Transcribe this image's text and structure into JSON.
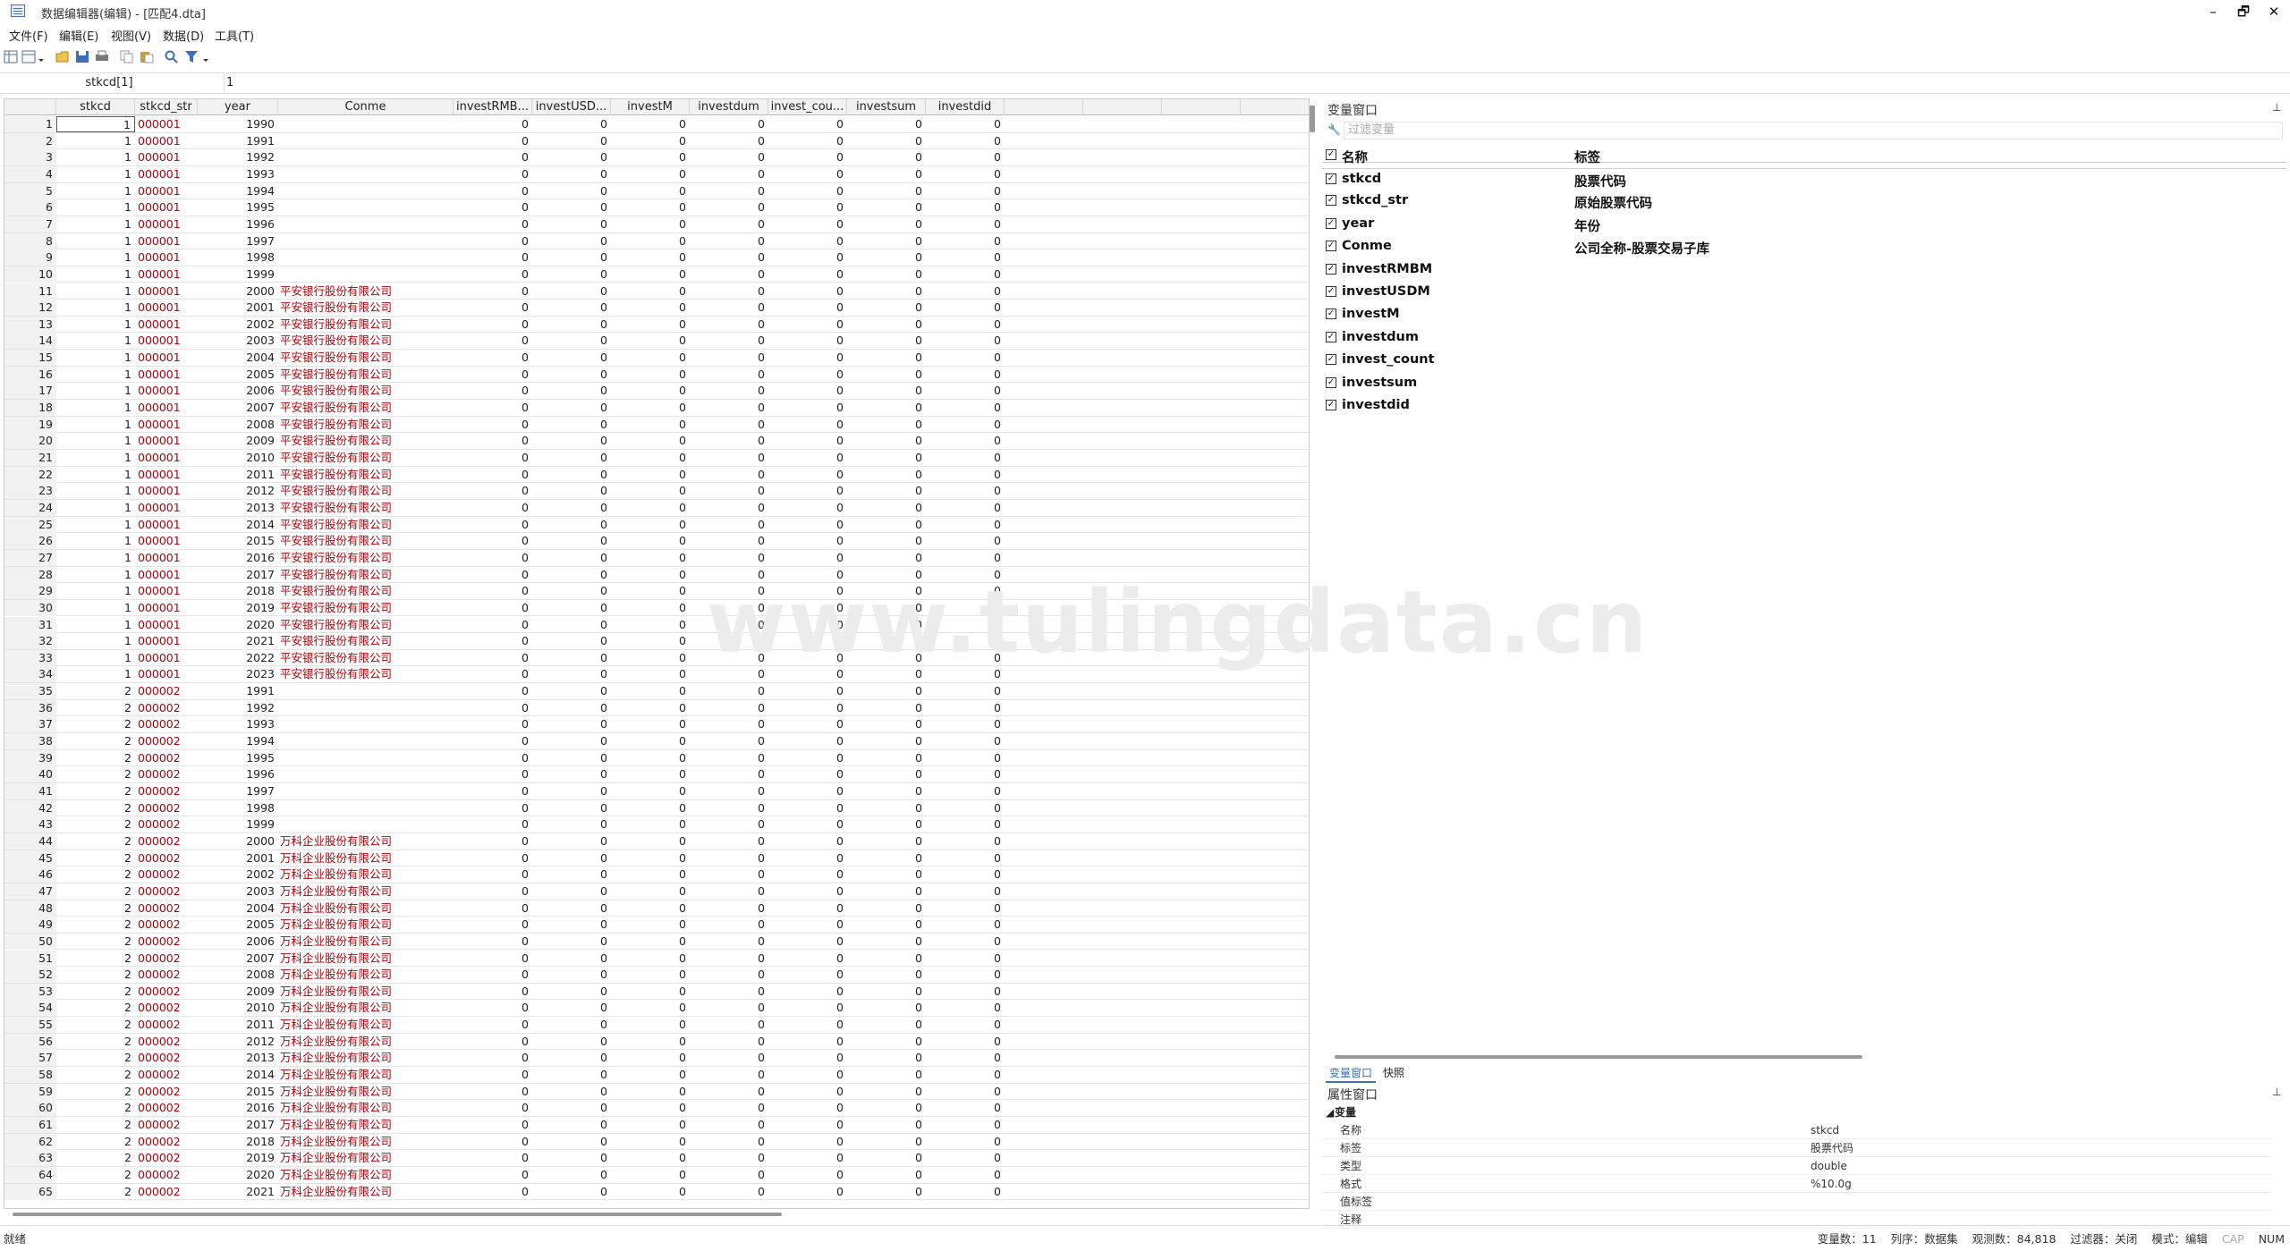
{
  "window": {
    "title": "数据编辑器(编辑) - [匹配4.dta]",
    "minimize": "–",
    "restore": "🗗",
    "close": "✕"
  },
  "menu": [
    "文件(F)",
    "编辑(E)",
    "视图(V)",
    "数据(D)",
    "工具(T)"
  ],
  "toolbar_icons": [
    "data-editor-icon",
    "view-dropdown-icon",
    "open-icon",
    "save-icon",
    "print-icon",
    "copy-icon",
    "paste-icon",
    "find-icon",
    "filter-icon"
  ],
  "editbar": {
    "cell_ref": "stkcd[1]",
    "cell_value": "1"
  },
  "grid": {
    "columns": [
      "stkcd",
      "stkcd_str",
      "year",
      "Conme",
      "investRMB...",
      "investUSD...",
      "investM",
      "investdum",
      "invest_cou...",
      "investsum",
      "investdid"
    ],
    "rows": [
      [
        "1",
        "1",
        "000001",
        "1990",
        "",
        "0",
        "0",
        "0",
        "0",
        "0",
        "0",
        "0"
      ],
      [
        "2",
        "1",
        "000001",
        "1991",
        "",
        "0",
        "0",
        "0",
        "0",
        "0",
        "0",
        "0"
      ],
      [
        "3",
        "1",
        "000001",
        "1992",
        "",
        "0",
        "0",
        "0",
        "0",
        "0",
        "0",
        "0"
      ],
      [
        "4",
        "1",
        "000001",
        "1993",
        "",
        "0",
        "0",
        "0",
        "0",
        "0",
        "0",
        "0"
      ],
      [
        "5",
        "1",
        "000001",
        "1994",
        "",
        "0",
        "0",
        "0",
        "0",
        "0",
        "0",
        "0"
      ],
      [
        "6",
        "1",
        "000001",
        "1995",
        "",
        "0",
        "0",
        "0",
        "0",
        "0",
        "0",
        "0"
      ],
      [
        "7",
        "1",
        "000001",
        "1996",
        "",
        "0",
        "0",
        "0",
        "0",
        "0",
        "0",
        "0"
      ],
      [
        "8",
        "1",
        "000001",
        "1997",
        "",
        "0",
        "0",
        "0",
        "0",
        "0",
        "0",
        "0"
      ],
      [
        "9",
        "1",
        "000001",
        "1998",
        "",
        "0",
        "0",
        "0",
        "0",
        "0",
        "0",
        "0"
      ],
      [
        "10",
        "1",
        "000001",
        "1999",
        "",
        "0",
        "0",
        "0",
        "0",
        "0",
        "0",
        "0"
      ],
      [
        "11",
        "1",
        "000001",
        "2000",
        "平安银行股份有限公司",
        "0",
        "0",
        "0",
        "0",
        "0",
        "0",
        "0"
      ],
      [
        "12",
        "1",
        "000001",
        "2001",
        "平安银行股份有限公司",
        "0",
        "0",
        "0",
        "0",
        "0",
        "0",
        "0"
      ],
      [
        "13",
        "1",
        "000001",
        "2002",
        "平安银行股份有限公司",
        "0",
        "0",
        "0",
        "0",
        "0",
        "0",
        "0"
      ],
      [
        "14",
        "1",
        "000001",
        "2003",
        "平安银行股份有限公司",
        "0",
        "0",
        "0",
        "0",
        "0",
        "0",
        "0"
      ],
      [
        "15",
        "1",
        "000001",
        "2004",
        "平安银行股份有限公司",
        "0",
        "0",
        "0",
        "0",
        "0",
        "0",
        "0"
      ],
      [
        "16",
        "1",
        "000001",
        "2005",
        "平安银行股份有限公司",
        "0",
        "0",
        "0",
        "0",
        "0",
        "0",
        "0"
      ],
      [
        "17",
        "1",
        "000001",
        "2006",
        "平安银行股份有限公司",
        "0",
        "0",
        "0",
        "0",
        "0",
        "0",
        "0"
      ],
      [
        "18",
        "1",
        "000001",
        "2007",
        "平安银行股份有限公司",
        "0",
        "0",
        "0",
        "0",
        "0",
        "0",
        "0"
      ],
      [
        "19",
        "1",
        "000001",
        "2008",
        "平安银行股份有限公司",
        "0",
        "0",
        "0",
        "0",
        "0",
        "0",
        "0"
      ],
      [
        "20",
        "1",
        "000001",
        "2009",
        "平安银行股份有限公司",
        "0",
        "0",
        "0",
        "0",
        "0",
        "0",
        "0"
      ],
      [
        "21",
        "1",
        "000001",
        "2010",
        "平安银行股份有限公司",
        "0",
        "0",
        "0",
        "0",
        "0",
        "0",
        "0"
      ],
      [
        "22",
        "1",
        "000001",
        "2011",
        "平安银行股份有限公司",
        "0",
        "0",
        "0",
        "0",
        "0",
        "0",
        "0"
      ],
      [
        "23",
        "1",
        "000001",
        "2012",
        "平安银行股份有限公司",
        "0",
        "0",
        "0",
        "0",
        "0",
        "0",
        "0"
      ],
      [
        "24",
        "1",
        "000001",
        "2013",
        "平安银行股份有限公司",
        "0",
        "0",
        "0",
        "0",
        "0",
        "0",
        "0"
      ],
      [
        "25",
        "1",
        "000001",
        "2014",
        "平安银行股份有限公司",
        "0",
        "0",
        "0",
        "0",
        "0",
        "0",
        "0"
      ],
      [
        "26",
        "1",
        "000001",
        "2015",
        "平安银行股份有限公司",
        "0",
        "0",
        "0",
        "0",
        "0",
        "0",
        "0"
      ],
      [
        "27",
        "1",
        "000001",
        "2016",
        "平安银行股份有限公司",
        "0",
        "0",
        "0",
        "0",
        "0",
        "0",
        "0"
      ],
      [
        "28",
        "1",
        "000001",
        "2017",
        "平安银行股份有限公司",
        "0",
        "0",
        "0",
        "0",
        "0",
        "0",
        "0"
      ],
      [
        "29",
        "1",
        "000001",
        "2018",
        "平安银行股份有限公司",
        "0",
        "0",
        "0",
        "0",
        "0",
        "0",
        "0"
      ],
      [
        "30",
        "1",
        "000001",
        "2019",
        "平安银行股份有限公司",
        "0",
        "0",
        "0",
        "0",
        "0",
        "0",
        "0"
      ],
      [
        "31",
        "1",
        "000001",
        "2020",
        "平安银行股份有限公司",
        "0",
        "0",
        "0",
        "0",
        "0",
        "0",
        "0"
      ],
      [
        "32",
        "1",
        "000001",
        "2021",
        "平安银行股份有限公司",
        "0",
        "0",
        "0",
        "0",
        "0",
        "0",
        "0"
      ],
      [
        "33",
        "1",
        "000001",
        "2022",
        "平安银行股份有限公司",
        "0",
        "0",
        "0",
        "0",
        "0",
        "0",
        "0"
      ],
      [
        "34",
        "1",
        "000001",
        "2023",
        "平安银行股份有限公司",
        "0",
        "0",
        "0",
        "0",
        "0",
        "0",
        "0"
      ],
      [
        "35",
        "2",
        "000002",
        "1991",
        "",
        "0",
        "0",
        "0",
        "0",
        "0",
        "0",
        "0"
      ],
      [
        "36",
        "2",
        "000002",
        "1992",
        "",
        "0",
        "0",
        "0",
        "0",
        "0",
        "0",
        "0"
      ],
      [
        "37",
        "2",
        "000002",
        "1993",
        "",
        "0",
        "0",
        "0",
        "0",
        "0",
        "0",
        "0"
      ],
      [
        "38",
        "2",
        "000002",
        "1994",
        "",
        "0",
        "0",
        "0",
        "0",
        "0",
        "0",
        "0"
      ],
      [
        "39",
        "2",
        "000002",
        "1995",
        "",
        "0",
        "0",
        "0",
        "0",
        "0",
        "0",
        "0"
      ],
      [
        "40",
        "2",
        "000002",
        "1996",
        "",
        "0",
        "0",
        "0",
        "0",
        "0",
        "0",
        "0"
      ],
      [
        "41",
        "2",
        "000002",
        "1997",
        "",
        "0",
        "0",
        "0",
        "0",
        "0",
        "0",
        "0"
      ],
      [
        "42",
        "2",
        "000002",
        "1998",
        "",
        "0",
        "0",
        "0",
        "0",
        "0",
        "0",
        "0"
      ],
      [
        "43",
        "2",
        "000002",
        "1999",
        "",
        "0",
        "0",
        "0",
        "0",
        "0",
        "0",
        "0"
      ],
      [
        "44",
        "2",
        "000002",
        "2000",
        "万科企业股份有限公司",
        "0",
        "0",
        "0",
        "0",
        "0",
        "0",
        "0"
      ],
      [
        "45",
        "2",
        "000002",
        "2001",
        "万科企业股份有限公司",
        "0",
        "0",
        "0",
        "0",
        "0",
        "0",
        "0"
      ],
      [
        "46",
        "2",
        "000002",
        "2002",
        "万科企业股份有限公司",
        "0",
        "0",
        "0",
        "0",
        "0",
        "0",
        "0"
      ],
      [
        "47",
        "2",
        "000002",
        "2003",
        "万科企业股份有限公司",
        "0",
        "0",
        "0",
        "0",
        "0",
        "0",
        "0"
      ],
      [
        "48",
        "2",
        "000002",
        "2004",
        "万科企业股份有限公司",
        "0",
        "0",
        "0",
        "0",
        "0",
        "0",
        "0"
      ],
      [
        "49",
        "2",
        "000002",
        "2005",
        "万科企业股份有限公司",
        "0",
        "0",
        "0",
        "0",
        "0",
        "0",
        "0"
      ],
      [
        "50",
        "2",
        "000002",
        "2006",
        "万科企业股份有限公司",
        "0",
        "0",
        "0",
        "0",
        "0",
        "0",
        "0"
      ],
      [
        "51",
        "2",
        "000002",
        "2007",
        "万科企业股份有限公司",
        "0",
        "0",
        "0",
        "0",
        "0",
        "0",
        "0"
      ],
      [
        "52",
        "2",
        "000002",
        "2008",
        "万科企业股份有限公司",
        "0",
        "0",
        "0",
        "0",
        "0",
        "0",
        "0"
      ],
      [
        "53",
        "2",
        "000002",
        "2009",
        "万科企业股份有限公司",
        "0",
        "0",
        "0",
        "0",
        "0",
        "0",
        "0"
      ],
      [
        "54",
        "2",
        "000002",
        "2010",
        "万科企业股份有限公司",
        "0",
        "0",
        "0",
        "0",
        "0",
        "0",
        "0"
      ],
      [
        "55",
        "2",
        "000002",
        "2011",
        "万科企业股份有限公司",
        "0",
        "0",
        "0",
        "0",
        "0",
        "0",
        "0"
      ],
      [
        "56",
        "2",
        "000002",
        "2012",
        "万科企业股份有限公司",
        "0",
        "0",
        "0",
        "0",
        "0",
        "0",
        "0"
      ],
      [
        "57",
        "2",
        "000002",
        "2013",
        "万科企业股份有限公司",
        "0",
        "0",
        "0",
        "0",
        "0",
        "0",
        "0"
      ],
      [
        "58",
        "2",
        "000002",
        "2014",
        "万科企业股份有限公司",
        "0",
        "0",
        "0",
        "0",
        "0",
        "0",
        "0"
      ],
      [
        "59",
        "2",
        "000002",
        "2015",
        "万科企业股份有限公司",
        "0",
        "0",
        "0",
        "0",
        "0",
        "0",
        "0"
      ],
      [
        "60",
        "2",
        "000002",
        "2016",
        "万科企业股份有限公司",
        "0",
        "0",
        "0",
        "0",
        "0",
        "0",
        "0"
      ],
      [
        "61",
        "2",
        "000002",
        "2017",
        "万科企业股份有限公司",
        "0",
        "0",
        "0",
        "0",
        "0",
        "0",
        "0"
      ],
      [
        "62",
        "2",
        "000002",
        "2018",
        "万科企业股份有限公司",
        "0",
        "0",
        "0",
        "0",
        "0",
        "0",
        "0"
      ],
      [
        "63",
        "2",
        "000002",
        "2019",
        "万科企业股份有限公司",
        "0",
        "0",
        "0",
        "0",
        "0",
        "0",
        "0"
      ],
      [
        "64",
        "2",
        "000002",
        "2020",
        "万科企业股份有限公司",
        "0",
        "0",
        "0",
        "0",
        "0",
        "0",
        "0"
      ],
      [
        "65",
        "2",
        "000002",
        "2021",
        "万科企业股份有限公司",
        "0",
        "0",
        "0",
        "0",
        "0",
        "0",
        "0"
      ]
    ]
  },
  "watermark": "www.tulingdata.cn",
  "variables_pane": {
    "title": "变量窗口",
    "filter_placeholder": "过滤变量",
    "header_name": "名称",
    "header_label": "标签",
    "vars": [
      {
        "name": "stkcd",
        "label": "股票代码"
      },
      {
        "name": "stkcd_str",
        "label": "原始股票代码"
      },
      {
        "name": "year",
        "label": "年份"
      },
      {
        "name": "Conme",
        "label": "公司全称-股票交易子库"
      },
      {
        "name": "investRMBM",
        "label": ""
      },
      {
        "name": "investUSDM",
        "label": ""
      },
      {
        "name": "investM",
        "label": ""
      },
      {
        "name": "investdum",
        "label": ""
      },
      {
        "name": "invest_count",
        "label": ""
      },
      {
        "name": "investsum",
        "label": ""
      },
      {
        "name": "investdid",
        "label": ""
      }
    ],
    "tabs": [
      "变量窗口",
      "快照"
    ]
  },
  "properties_pane": {
    "title": "属性窗口",
    "section": "变量",
    "props": [
      {
        "key": "名称",
        "value": "stkcd"
      },
      {
        "key": "标签",
        "value": "股票代码"
      },
      {
        "key": "类型",
        "value": "double"
      },
      {
        "key": "格式",
        "value": "%10.0g"
      },
      {
        "key": "值标签",
        "value": ""
      },
      {
        "key": "注释",
        "value": ""
      }
    ]
  },
  "status": {
    "left": "就绪",
    "vars": "变量数：11",
    "order": "列序：数据集",
    "obs": "观测数：84,818",
    "filter": "过滤器：关闭",
    "mode": "模式：编辑",
    "cap": "CAP",
    "num": "NUM"
  },
  "colors": {
    "string_cell": "#b0000a",
    "header_bg": "#f2f2f2"
  }
}
